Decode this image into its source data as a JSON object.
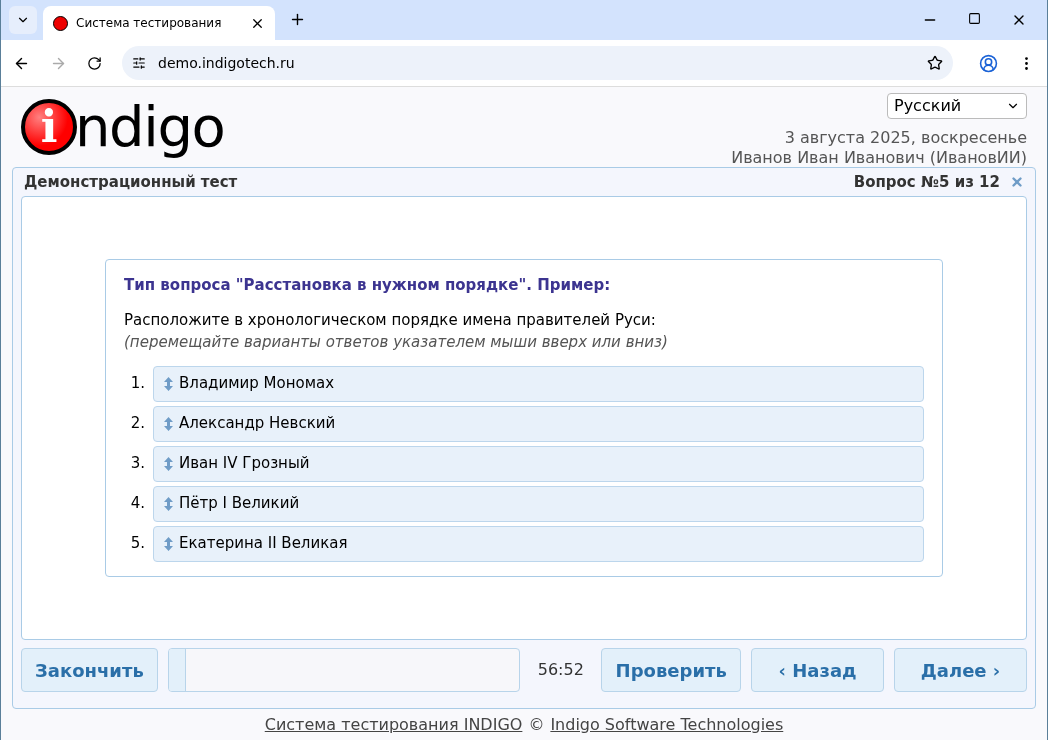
{
  "browser": {
    "tab_title": "Система тестирования",
    "url": "demo.indigotech.ru"
  },
  "header": {
    "logo": {
      "badge_letter": "i",
      "text": "ndigo"
    },
    "language": "Русский",
    "date": "3 августа 2025, воскресенье",
    "user": "Иванов Иван Иванович (ИвановИИ)"
  },
  "panel": {
    "title": "Демонстрационный тест",
    "question_counter": "Вопрос №5 из 12"
  },
  "question": {
    "type_title": "Тип вопроса \"Расстановка в нужном порядке\". Пример:",
    "prompt": "Расположите в хронологическом порядке имена правителей Руси:",
    "hint": "(перемещайте варианты ответов указателем мыши вверх или вниз)",
    "items": [
      {
        "number": "1.",
        "label": "Владимир Мономах"
      },
      {
        "number": "2.",
        "label": "Александр Невский"
      },
      {
        "number": "3.",
        "label": "Иван IV Грозный"
      },
      {
        "number": "4.",
        "label": "Пётр I Великий"
      },
      {
        "number": "5.",
        "label": "Екатерина II Великая"
      }
    ]
  },
  "footer_bar": {
    "finish": "Закончить",
    "progress": {
      "level": 0.05
    },
    "timer": "56:52",
    "check": "Проверить",
    "back": "‹ Назад",
    "next": "Далее ›"
  },
  "footer": {
    "link_system": "Система тестирования INDIGO",
    "copyright": "©",
    "link_company": "Indigo Software Technologies"
  }
}
